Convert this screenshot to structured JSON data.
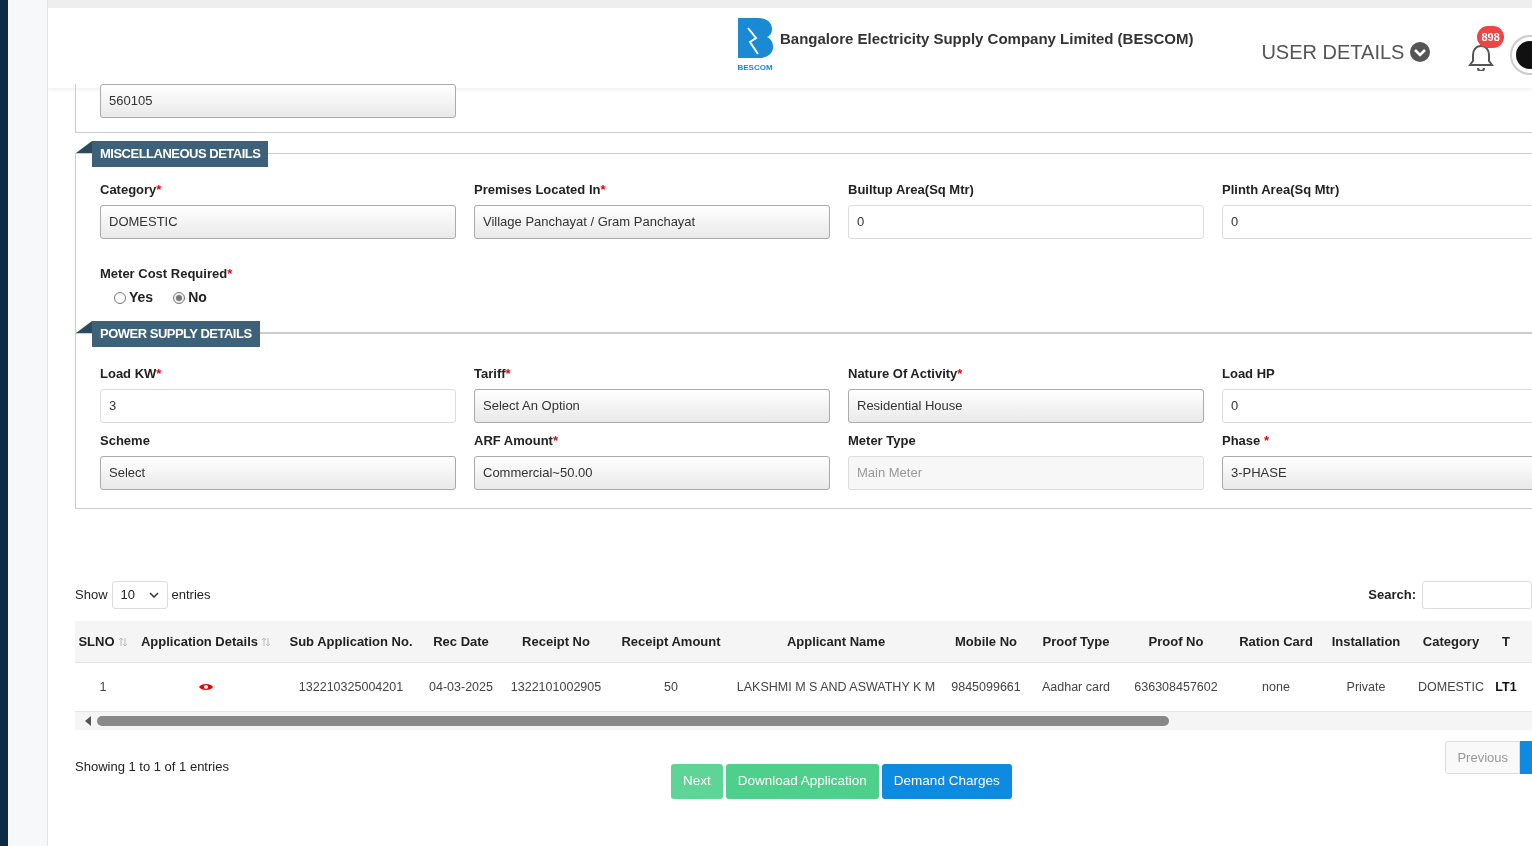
{
  "header": {
    "logo_text": "BESCOM",
    "company": "Bangalore Electricity Supply Company Limited (BESCOM)",
    "user_menu": "USER DETAILS",
    "notification_count": "898"
  },
  "address_panel": {
    "fields": [
      {
        "kind": "select",
        "value": "560105"
      }
    ]
  },
  "miscellaneous": {
    "title": "MISCELLANEOUS DETAILS",
    "fields": [
      {
        "label": "Category",
        "required_mark": "*",
        "kind": "select",
        "value": "DOMESTIC"
      },
      {
        "label": "Premises Located In",
        "required_mark": "*",
        "kind": "select",
        "value": "Village Panchayat / Gram Panchayat"
      },
      {
        "label": "Builtup Area(Sq Mtr)",
        "kind": "input",
        "value": "0"
      },
      {
        "label": "Plinth Area(Sq Mtr)",
        "kind": "input",
        "value": "0"
      }
    ],
    "meter_cost": {
      "label": "Meter Cost Required",
      "required_mark": "*",
      "options": [
        {
          "label": "Yes",
          "selected": false
        },
        {
          "label": "No",
          "selected": true
        }
      ]
    }
  },
  "power_supply": {
    "title": "POWER SUPPLY DETAILS",
    "fields": [
      {
        "label": "Load KW",
        "required_mark": "*",
        "kind": "input",
        "value": "3"
      },
      {
        "label": "Tariff",
        "required_mark": "*",
        "kind": "select",
        "value": "Select An Option"
      },
      {
        "label": "Nature Of Activity",
        "required_mark": "*",
        "kind": "select",
        "value": "Residential House"
      },
      {
        "label": "Load HP",
        "kind": "input",
        "value": "0"
      },
      {
        "label": "Scheme",
        "kind": "select",
        "value": "Select"
      },
      {
        "label": "ARF Amount",
        "required_mark": "*",
        "kind": "select",
        "value": "Commercial~50.00"
      },
      {
        "label": "Meter Type",
        "kind": "readonly",
        "value": "Main Meter"
      },
      {
        "label": "Phase ",
        "required_mark": "*",
        "kind": "select",
        "value": "3-PHASE"
      }
    ]
  },
  "table": {
    "show_label": "Show",
    "page_size": "10",
    "entries_label": "entries",
    "search_label": "Search:",
    "columns": [
      {
        "label": "SLNO",
        "sortable": true
      },
      {
        "label": "Application Details",
        "sortable": true
      },
      {
        "label": "Sub Application No.",
        "sortable": false
      },
      {
        "label": "Rec Date",
        "sortable": false
      },
      {
        "label": "Receipt No",
        "sortable": false
      },
      {
        "label": "Receipt Amount",
        "sortable": false
      },
      {
        "label": "Applicant Name",
        "sortable": false
      },
      {
        "label": "Mobile No",
        "sortable": false
      },
      {
        "label": "Proof Type",
        "sortable": false
      },
      {
        "label": "Proof No",
        "sortable": false
      },
      {
        "label": "Ration Card",
        "sortable": false
      },
      {
        "label": "Installation",
        "sortable": false
      },
      {
        "label": "Category",
        "sortable": false
      },
      {
        "label": "T",
        "sortable": false
      }
    ],
    "rows": [
      {
        "cells": [
          "1",
          {
            "kind": "view"
          },
          "132210325004201",
          "04-03-2025",
          "1322101002905",
          "50",
          "LAKSHMI M S AND ASWATHY K M",
          "9845099661",
          "Aadhar card",
          "636308457602",
          "none",
          "Private",
          "DOMESTIC",
          "LT1"
        ]
      }
    ],
    "info": "Showing 1 to 1 of 1 entries",
    "previous": "Previous"
  },
  "buttons": [
    {
      "label": "Next",
      "kind": "faded"
    },
    {
      "label": "Download Application",
      "kind": "success"
    },
    {
      "label": "Demand Charges",
      "kind": "primary"
    }
  ]
}
